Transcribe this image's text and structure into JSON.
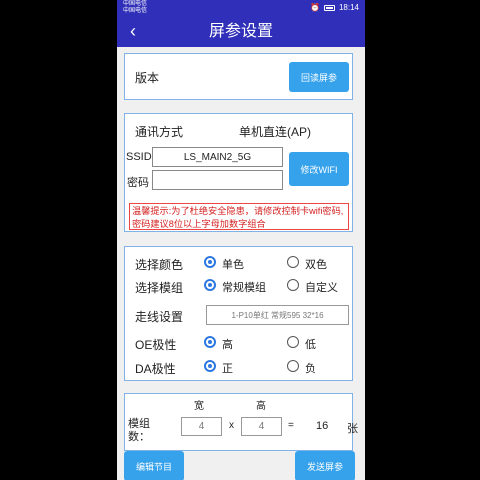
{
  "status": {
    "carrier_line1": "中国电信",
    "carrier_line2": "中国电信",
    "time": "18:14"
  },
  "header": {
    "title": "屏参设置",
    "back_icon": "chevron-left-icon"
  },
  "version": {
    "label": "版本",
    "read_button": "回读屏参"
  },
  "comm": {
    "mode_label": "通讯方式",
    "mode_value": "单机直连(AP)",
    "ssid_label": "SSID",
    "ssid_value": "LS_MAIN2_5G",
    "password_label": "密码",
    "password_value": "",
    "modify_button": "修改WIFI",
    "warning": "温馨提示:为了杜绝安全隐患，请修改控制卡wifi密码,密码建议8位以上字母加数字组合",
    "warning_color": "#d42020"
  },
  "settings": {
    "color_label": "选择颜色",
    "color_options": [
      "单色",
      "双色"
    ],
    "color_selected": "单色",
    "module_label": "选择模组",
    "module_options": [
      "常规模组",
      "自定义"
    ],
    "module_selected": "常规模组",
    "wiring_label": "走线设置",
    "wiring_value": "1-P10单红 常规595 32*16",
    "oe_label": "OE极性",
    "oe_options": [
      "高",
      "低"
    ],
    "oe_selected": "高",
    "da_label": "DA极性",
    "da_options": [
      "正",
      "负"
    ],
    "da_selected": "正"
  },
  "modules": {
    "label": "模组数：",
    "width_header": "宽",
    "height_header": "高",
    "width_value": "4",
    "height_value": "4",
    "times": "x",
    "equals": "=",
    "total": "16",
    "unit": "张"
  },
  "footer": {
    "edit_button": "编辑节目",
    "send_button": "发送屏参"
  },
  "colors": {
    "primary": "#2f2fb9",
    "button": "#36a2ec",
    "border": "#7fb3e8"
  }
}
